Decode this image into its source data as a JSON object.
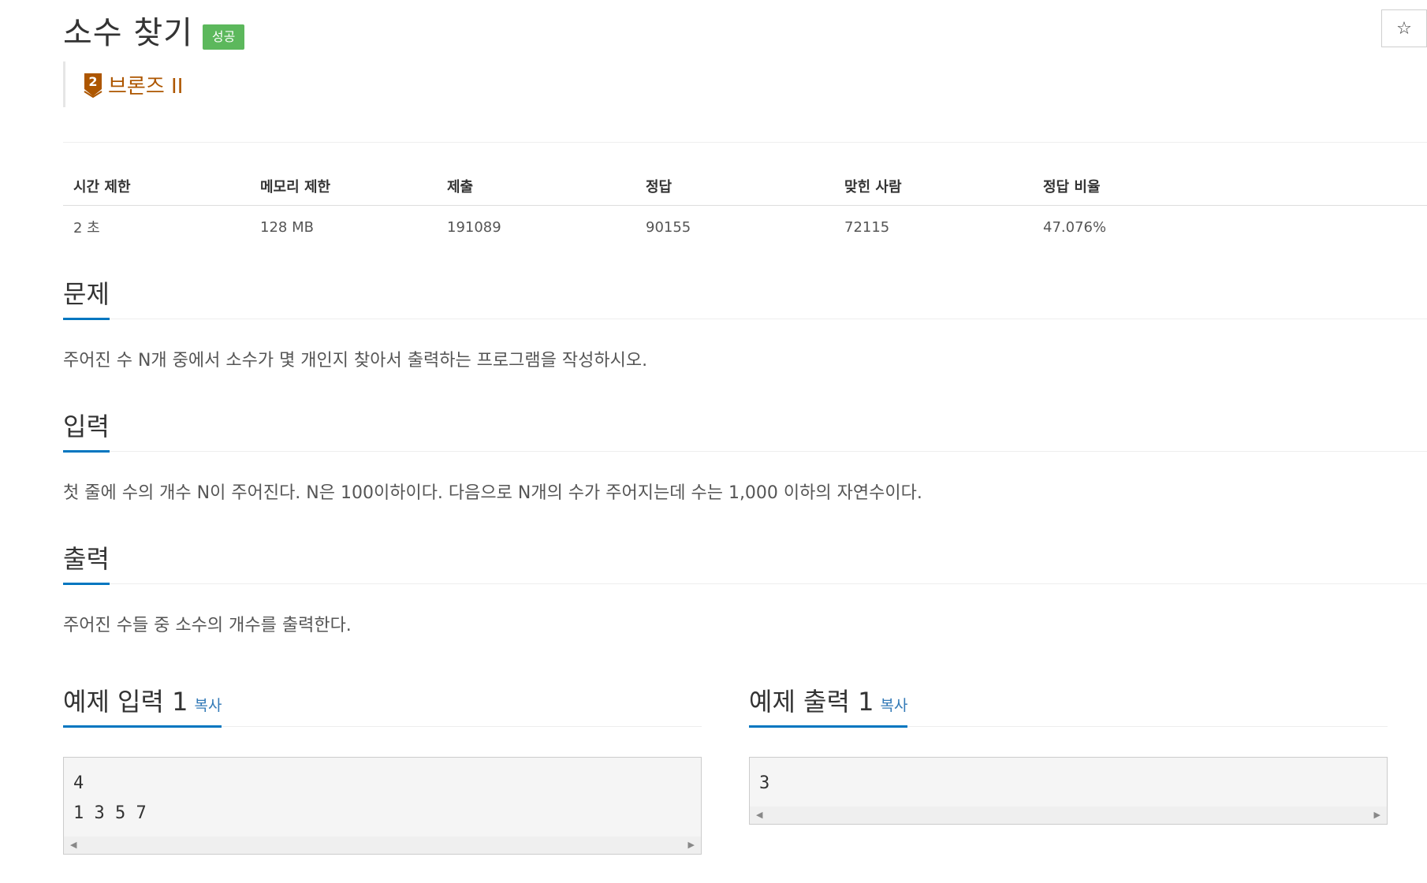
{
  "problem": {
    "title": "소수 찾기",
    "result_badge": "성공",
    "star_icon": "☆",
    "tier": {
      "number": "2",
      "label": "브론즈 II",
      "color": "#ad5600"
    }
  },
  "stats": {
    "headers": [
      "시간 제한",
      "메모리 제한",
      "제출",
      "정답",
      "맞힌 사람",
      "정답 비율"
    ],
    "values": [
      "2 초",
      "128 MB",
      "191089",
      "90155",
      "72115",
      "47.076%"
    ]
  },
  "sections": {
    "problem": {
      "title": "문제",
      "text": "주어진 수 N개 중에서 소수가 몇 개인지 찾아서 출력하는 프로그램을 작성하시오."
    },
    "input": {
      "title": "입력",
      "text": "첫 줄에 수의 개수 N이 주어진다. N은 100이하이다. 다음으로 N개의 수가 주어지는데 수는 1,000 이하의 자연수이다."
    },
    "output": {
      "title": "출력",
      "text": "주어진 수들 중 소수의 개수를 출력한다."
    }
  },
  "samples": {
    "input": {
      "title": "예제 입력 1",
      "copy_label": "복사",
      "content": "4\n1 3 5 7"
    },
    "output": {
      "title": "예제 출력 1",
      "copy_label": "복사",
      "content": "3"
    }
  },
  "colors": {
    "accent": "#0076c0",
    "success": "#5cb85c",
    "link": "#337ab7"
  }
}
